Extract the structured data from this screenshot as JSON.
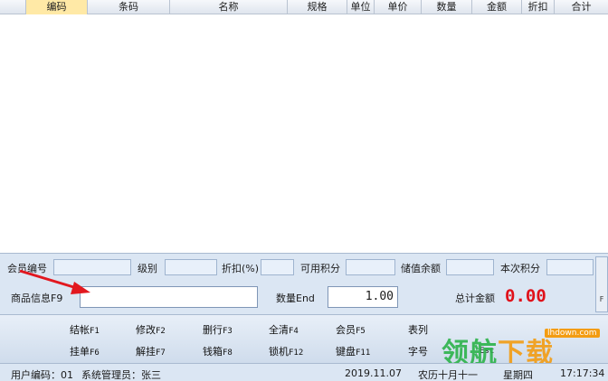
{
  "table": {
    "columns": [
      "",
      "编码",
      "条码",
      "名称",
      "规格",
      "单位",
      "单价",
      "数量",
      "金额",
      "折扣",
      "合计"
    ],
    "active_column": "编码"
  },
  "member": {
    "labels": [
      "会员编号",
      "级别",
      "折扣(%)",
      "可用积分",
      "储值余额",
      "本次积分"
    ],
    "values": [
      "",
      "",
      "",
      "",
      "",
      ""
    ]
  },
  "input": {
    "product_label": "商品信息F9",
    "product_value": "",
    "qty_label": "数量End",
    "qty_value": "1.00",
    "total_label": "总计金额",
    "total_value": "0.00"
  },
  "side_strip": "F",
  "fkeys": {
    "row1": [
      {
        "label": "结帐",
        "key": "F1"
      },
      {
        "label": "修改",
        "key": "F2"
      },
      {
        "label": "删行",
        "key": "F3"
      },
      {
        "label": "全清",
        "key": "F4"
      },
      {
        "label": "会员",
        "key": "F5"
      },
      {
        "label": "表列",
        "key": ""
      }
    ],
    "row2": [
      {
        "label": "挂单",
        "key": "F6"
      },
      {
        "label": "解挂",
        "key": "F7"
      },
      {
        "label": "钱箱",
        "key": "F8"
      },
      {
        "label": "锁机",
        "key": "F12"
      },
      {
        "label": "键盘",
        "key": "F11"
      },
      {
        "label": "字号",
        "key": ""
      }
    ],
    "row2_extra": "Esc"
  },
  "watermark": {
    "text_green": "领航",
    "text_orange": "下载",
    "url": "lhdown.com"
  },
  "status": {
    "user_code": "用户编码：01",
    "user_name": "系统管理员：张三",
    "date": "2019.11.07",
    "lunar": "农历十月十一",
    "weekday": "星期四",
    "time": "17:17:34"
  }
}
